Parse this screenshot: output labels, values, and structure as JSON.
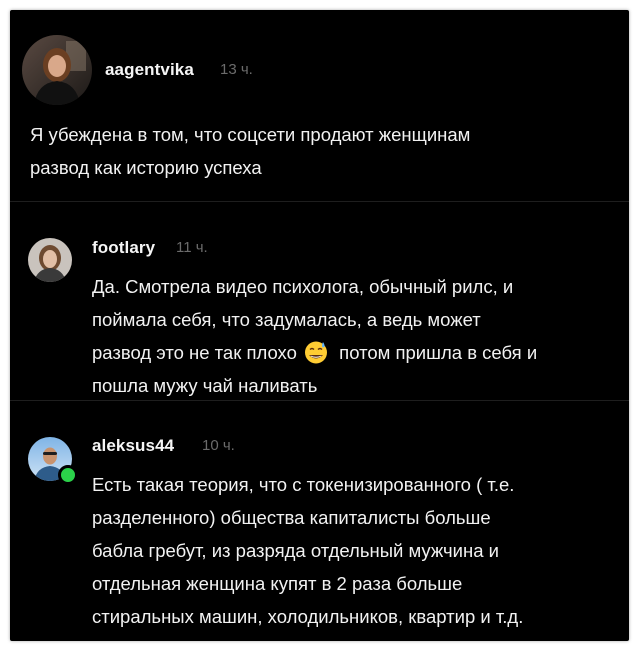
{
  "comments": [
    {
      "username": "aagentvika",
      "time": "13 ч.",
      "lines": [
        "Я убеждена в том, что соцсети продают женщинам",
        "развод как историю успеха"
      ],
      "online": false
    },
    {
      "username": "footlary",
      "time": "11 ч.",
      "lines": [
        "Да. Смотрела видео психолога, обычный рилс, и",
        "поймала себя, что задумалась, а ведь может",
        "развод это не так плохо",
        "потом пришла в себя и",
        "пошла мужу чай наливать"
      ],
      "emoji": "grinning-sweat-emoji",
      "online": false
    },
    {
      "username": "aleksus44",
      "time": "10 ч.",
      "lines": [
        "Есть такая теория, что с токенизированного ( т.е.",
        "разделенного) общества капиталисты больше",
        "бабла гребут, из разряда отдельный мужчина и",
        "отдельная женщина купят в 2 раза больше",
        "стиральных машин, холодильников, квартир и т.д."
      ],
      "online": true
    }
  ],
  "colors": {
    "background": "#000000",
    "text": "#f2f2f2",
    "time": "#6b6b6b",
    "online": "#2bd14a"
  }
}
